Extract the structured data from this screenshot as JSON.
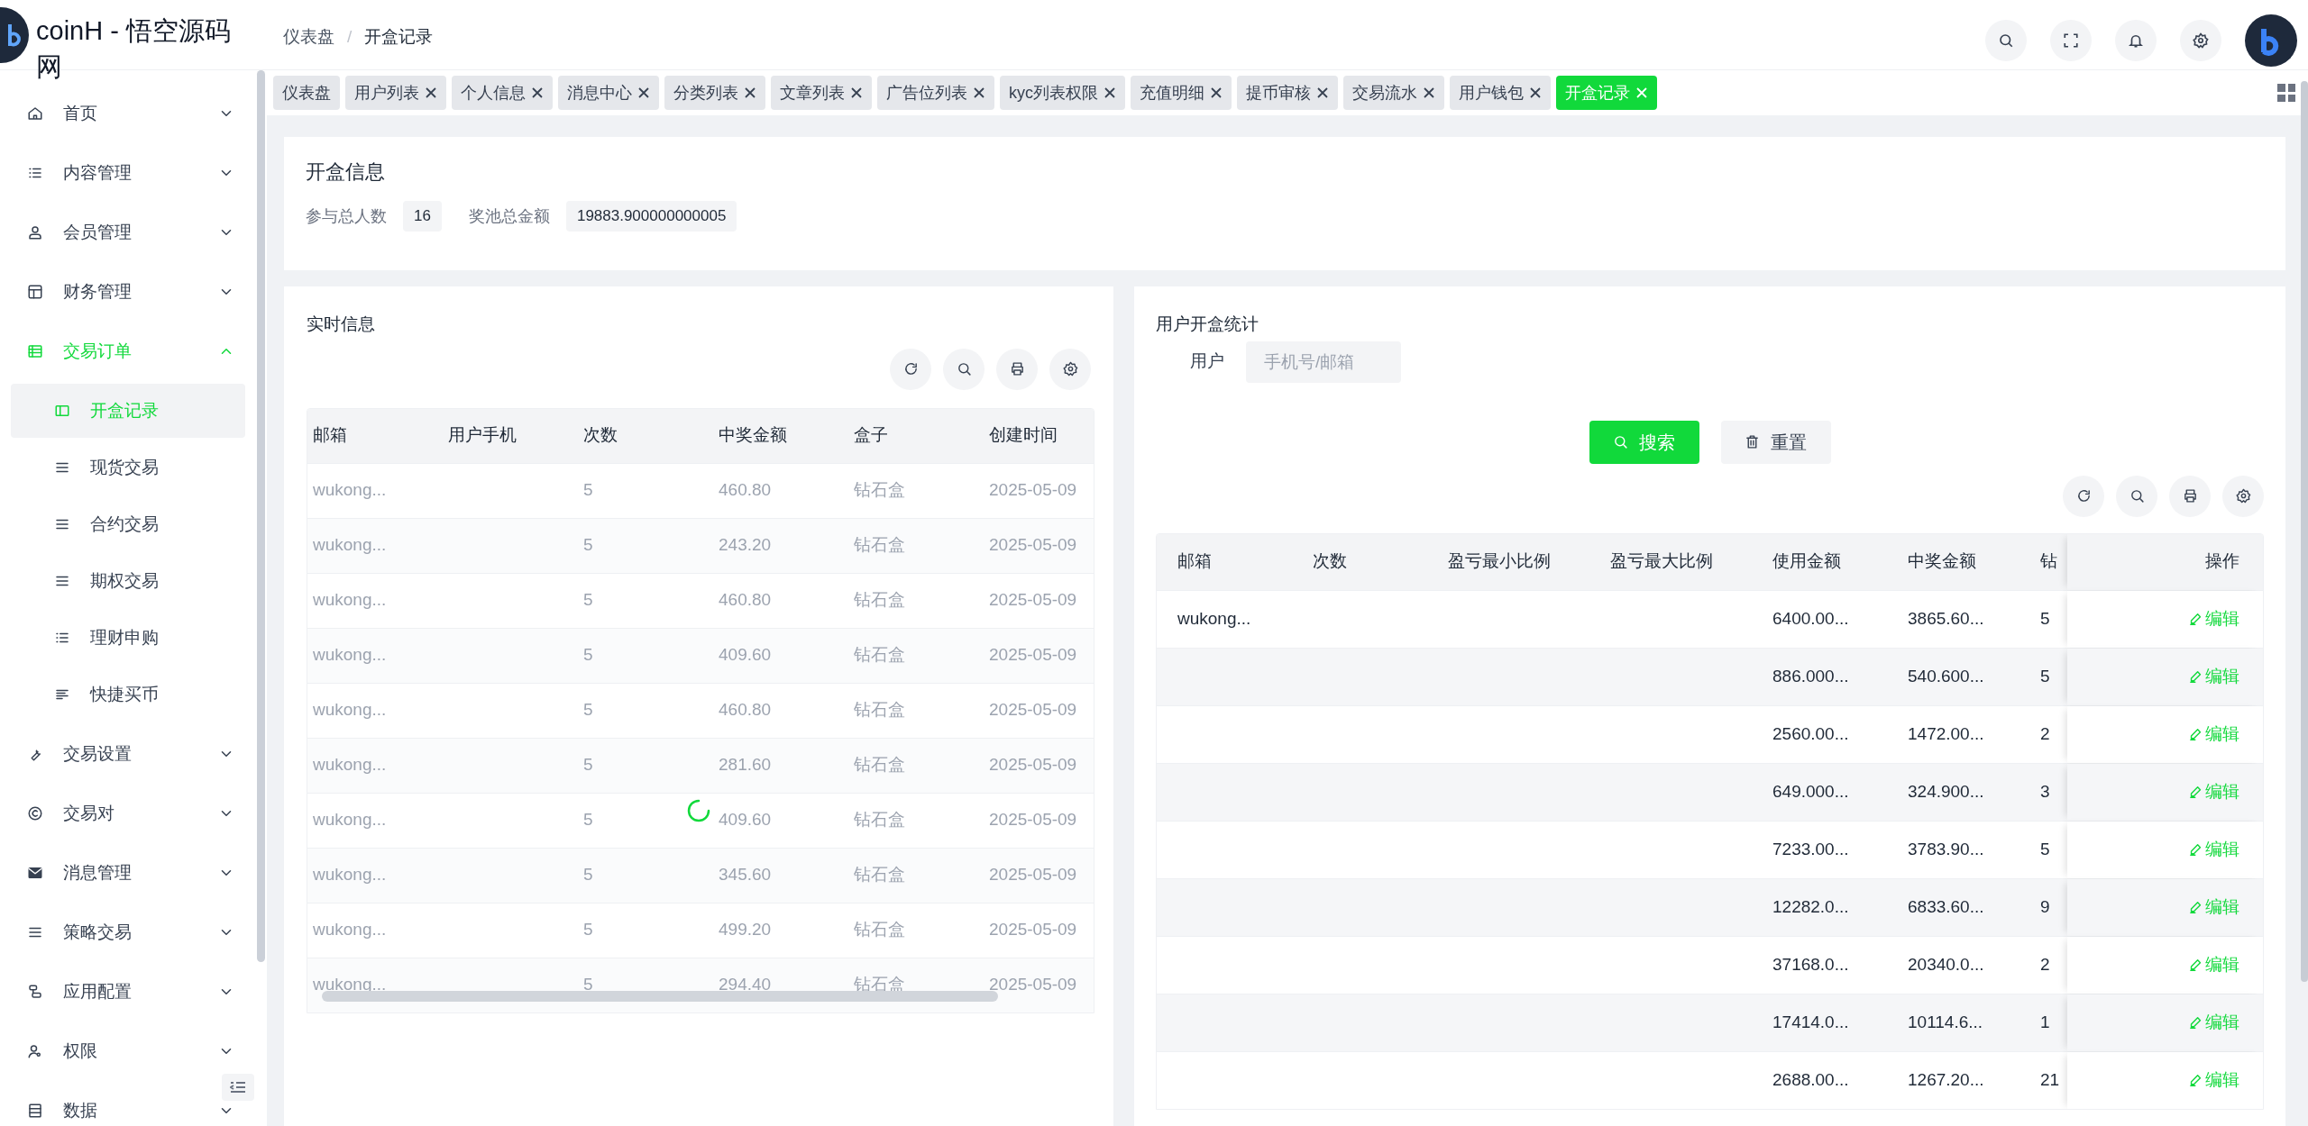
{
  "header": {
    "title": "coinH - 悟空源码网",
    "separator": "/",
    "breadcrumb": [
      {
        "label": "仪表盘",
        "current": false
      },
      {
        "label": "开盒记录",
        "current": true
      }
    ]
  },
  "sidebar": {
    "items": [
      {
        "label": "首页",
        "expanded": false,
        "selected": false
      },
      {
        "label": "内容管理",
        "expanded": false,
        "selected": false
      },
      {
        "label": "会员管理",
        "expanded": false,
        "selected": false
      },
      {
        "label": "财务管理",
        "expanded": false,
        "selected": false
      },
      {
        "label": "交易订单",
        "expanded": true,
        "selected": true,
        "children": [
          {
            "label": "开盒记录",
            "selected": true
          },
          {
            "label": "现货交易",
            "selected": false
          },
          {
            "label": "合约交易",
            "selected": false
          },
          {
            "label": "期权交易",
            "selected": false
          },
          {
            "label": "理财申购",
            "selected": false
          },
          {
            "label": "快捷买币",
            "selected": false
          }
        ]
      },
      {
        "label": "交易设置",
        "expanded": false,
        "selected": false
      },
      {
        "label": "交易对",
        "expanded": false,
        "selected": false
      },
      {
        "label": "消息管理",
        "expanded": false,
        "selected": false
      },
      {
        "label": "策略交易",
        "expanded": false,
        "selected": false
      },
      {
        "label": "应用配置",
        "expanded": false,
        "selected": false
      },
      {
        "label": "权限",
        "expanded": false,
        "selected": false
      },
      {
        "label": "数据",
        "expanded": false,
        "selected": false
      }
    ]
  },
  "tabs": [
    {
      "label": "仪表盘",
      "closable": false,
      "selected": false
    },
    {
      "label": "用户列表",
      "closable": true,
      "selected": false
    },
    {
      "label": "个人信息",
      "closable": true,
      "selected": false
    },
    {
      "label": "消息中心",
      "closable": true,
      "selected": false
    },
    {
      "label": "分类列表",
      "closable": true,
      "selected": false
    },
    {
      "label": "文章列表",
      "closable": true,
      "selected": false
    },
    {
      "label": "广告位列表",
      "closable": true,
      "selected": false
    },
    {
      "label": "kyc列表权限",
      "closable": true,
      "selected": false
    },
    {
      "label": "充值明细",
      "closable": true,
      "selected": false
    },
    {
      "label": "提币审核",
      "closable": true,
      "selected": false
    },
    {
      "label": "交易流水",
      "closable": true,
      "selected": false
    },
    {
      "label": "用户钱包",
      "closable": true,
      "selected": false
    },
    {
      "label": "开盒记录",
      "closable": true,
      "selected": true
    }
  ],
  "summary": {
    "title": "开盒信息",
    "stats": [
      {
        "label": "参与总人数",
        "value": "16"
      },
      {
        "label": "奖池总金额",
        "value": "19883.900000000005"
      }
    ]
  },
  "live": {
    "title": "实时信息",
    "loading": true,
    "columns": [
      "邮箱",
      "用户手机",
      "次数",
      "中奖金额",
      "盒子",
      "创建时间"
    ],
    "rows": [
      {
        "email": "wukong...",
        "count": "5",
        "prize": "460.80",
        "box": "钻石盒",
        "created": "2025-05-09"
      },
      {
        "email": "wukong...",
        "count": "5",
        "prize": "243.20",
        "box": "钻石盒",
        "created": "2025-05-09"
      },
      {
        "email": "wukong...",
        "count": "5",
        "prize": "460.80",
        "box": "钻石盒",
        "created": "2025-05-09"
      },
      {
        "email": "wukong...",
        "count": "5",
        "prize": "409.60",
        "box": "钻石盒",
        "created": "2025-05-09"
      },
      {
        "email": "wukong...",
        "count": "5",
        "prize": "460.80",
        "box": "钻石盒",
        "created": "2025-05-09"
      },
      {
        "email": "wukong...",
        "count": "5",
        "prize": "281.60",
        "box": "钻石盒",
        "created": "2025-05-09"
      },
      {
        "email": "wukong...",
        "count": "5",
        "prize": "409.60",
        "box": "钻石盒",
        "created": "2025-05-09"
      },
      {
        "email": "wukong...",
        "count": "5",
        "prize": "345.60",
        "box": "钻石盒",
        "created": "2025-05-09"
      },
      {
        "email": "wukong...",
        "count": "5",
        "prize": "499.20",
        "box": "钻石盒",
        "created": "2025-05-09"
      },
      {
        "email": "wukong...",
        "count": "5",
        "prize": "294.40",
        "box": "钻石盒",
        "created": "2025-05-09"
      }
    ]
  },
  "stats": {
    "title": "用户开盒统计",
    "filter": {
      "label": "用户",
      "placeholder": "手机号/邮箱"
    },
    "buttons": [
      {
        "label": "搜索",
        "kind": "primary"
      },
      {
        "label": "重置",
        "kind": "reset"
      }
    ],
    "columns": [
      "邮箱",
      "次数",
      "盈亏最小比例",
      "盈亏最大比例",
      "使用金额",
      "中奖金额",
      "钻",
      "操作"
    ],
    "rows": [
      {
        "email": "wukong...",
        "used": "6400.00...",
        "prize": "3865.60...",
        "column_7": "5",
        "action": "编辑"
      },
      {
        "used": "886.000...",
        "prize": "540.600...",
        "column_7": "5",
        "action": "编辑"
      },
      {
        "used": "2560.00...",
        "prize": "1472.00...",
        "column_7": "2",
        "action": "编辑"
      },
      {
        "used": "649.000...",
        "prize": "324.900...",
        "column_7": "3",
        "action": "编辑"
      },
      {
        "used": "7233.00...",
        "prize": "3783.90...",
        "column_7": "5",
        "action": "编辑"
      },
      {
        "used": "12282.0...",
        "prize": "6833.60...",
        "column_7": "9",
        "action": "编辑"
      },
      {
        "used": "37168.0...",
        "prize": "20340.0...",
        "column_7": "2",
        "action": "编辑"
      },
      {
        "used": "17414.0...",
        "prize": "10114.6...",
        "column_7": "1",
        "action": "编辑"
      },
      {
        "used": "2688.00...",
        "prize": "1267.20...",
        "column_7": "21",
        "action": "编辑"
      }
    ]
  }
}
